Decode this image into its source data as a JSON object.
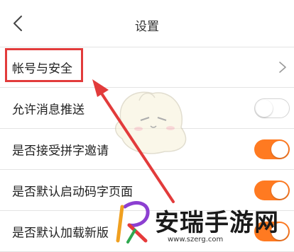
{
  "header": {
    "title": "设置",
    "back_icon": "chevron-left-icon"
  },
  "settings": {
    "account_security": {
      "label": "帐号与安全",
      "icon": "chevron-right-icon"
    },
    "allow_push": {
      "label": "允许消息推送",
      "enabled": false
    },
    "accept_invites": {
      "label": "是否接受拼字邀请",
      "enabled": true
    },
    "default_code_page": {
      "label": "是否默认启动码字页面",
      "enabled": true
    },
    "default_load_new": {
      "label": "是否默认加载新版",
      "enabled": true
    }
  },
  "colors": {
    "accent": "#ff7a21",
    "highlight": "#e23b3b"
  },
  "watermark": {
    "name": "安瑞手游网",
    "url": "www.szerg.com"
  }
}
